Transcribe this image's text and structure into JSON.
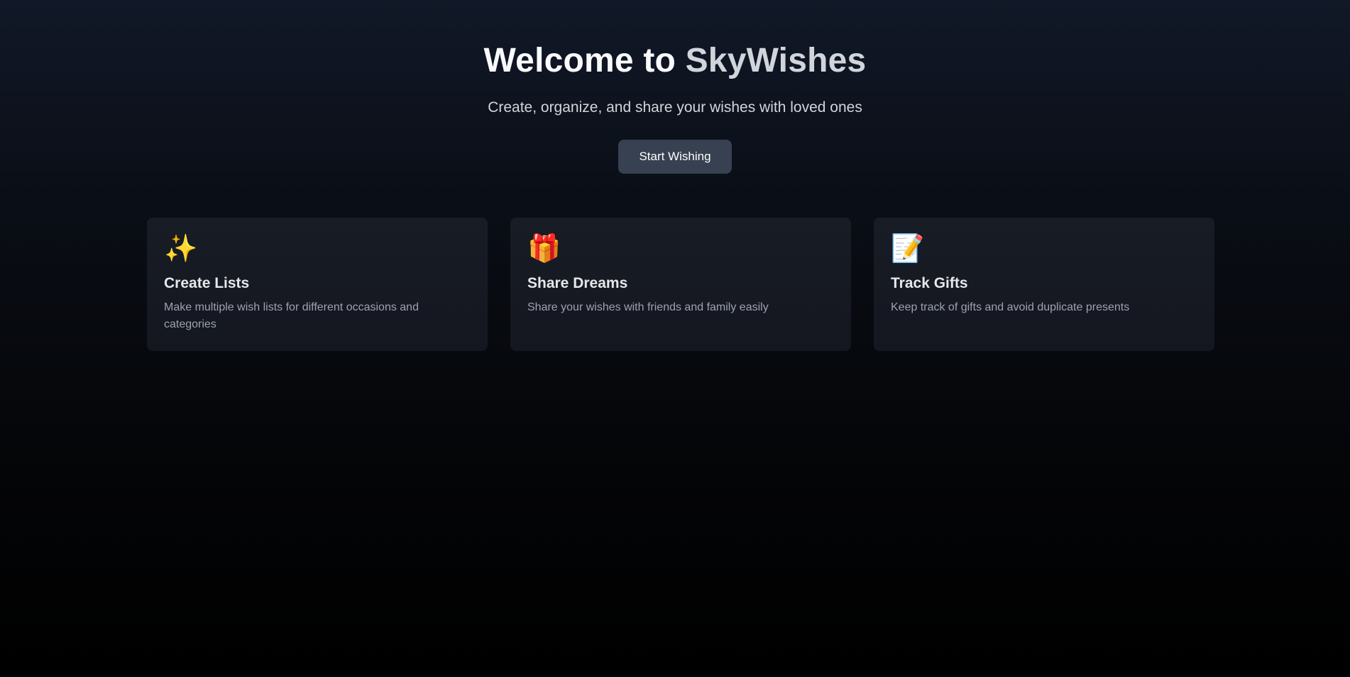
{
  "hero": {
    "title_prefix": "Welcome to ",
    "title_brand": "SkyWishes",
    "subtitle": "Create, organize, and share your wishes with loved ones",
    "cta_label": "Start Wishing"
  },
  "features": [
    {
      "icon": "✨",
      "icon_name": "sparkles-icon",
      "title": "Create Lists",
      "description": "Make multiple wish lists for different occasions and categories"
    },
    {
      "icon": "🎁",
      "icon_name": "gift-icon",
      "title": "Share Dreams",
      "description": "Share your wishes with friends and family easily"
    },
    {
      "icon": "📝",
      "icon_name": "memo-icon",
      "title": "Track Gifts",
      "description": "Keep track of gifts and avoid duplicate presents"
    }
  ],
  "colors": {
    "background_top": "#111827",
    "background_bottom": "#000000",
    "button_bg": "#374151",
    "card_bg": "#181c25",
    "brand_text": "#d1d5db"
  }
}
